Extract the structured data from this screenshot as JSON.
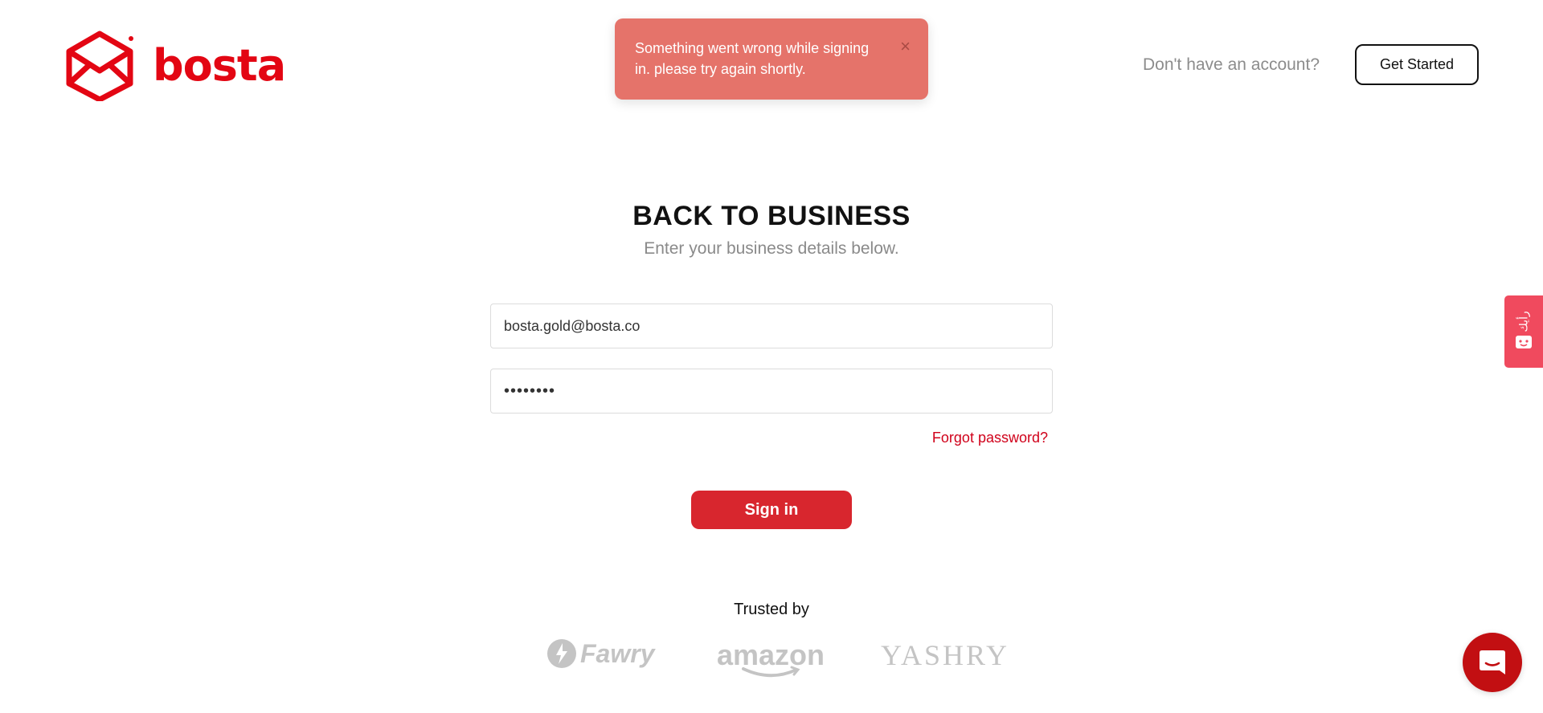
{
  "header": {
    "logo_text": "bosta",
    "no_account_text": "Don't have an account?",
    "get_started_label": "Get Started"
  },
  "toast": {
    "message": "Something went wrong while signing in. please try again shortly.",
    "close_icon": "×"
  },
  "form": {
    "title": "BACK TO BUSINESS",
    "subtitle": "Enter your business details below.",
    "email_value": "bosta.gold@bosta.co",
    "password_value": "••••••••",
    "forgot_label": "Forgot password?",
    "signin_label": "Sign in"
  },
  "trusted": {
    "heading": "Trusted by",
    "brands": [
      "Fawry",
      "amazon",
      "YASHRY"
    ]
  },
  "side_tab": {
    "text": "رأيك"
  },
  "colors": {
    "brand_red": "#e30613",
    "toast_bg": "#e5736a",
    "signin_bg": "#d8262e",
    "link_red": "#d0021b",
    "side_tab_bg": "#f04a5e",
    "chat_bg": "#c20f12"
  },
  "icons": {
    "logo": "box-envelope-icon",
    "close": "close-icon",
    "side_tab": "chat-face-icon",
    "chat": "messenger-icon"
  }
}
